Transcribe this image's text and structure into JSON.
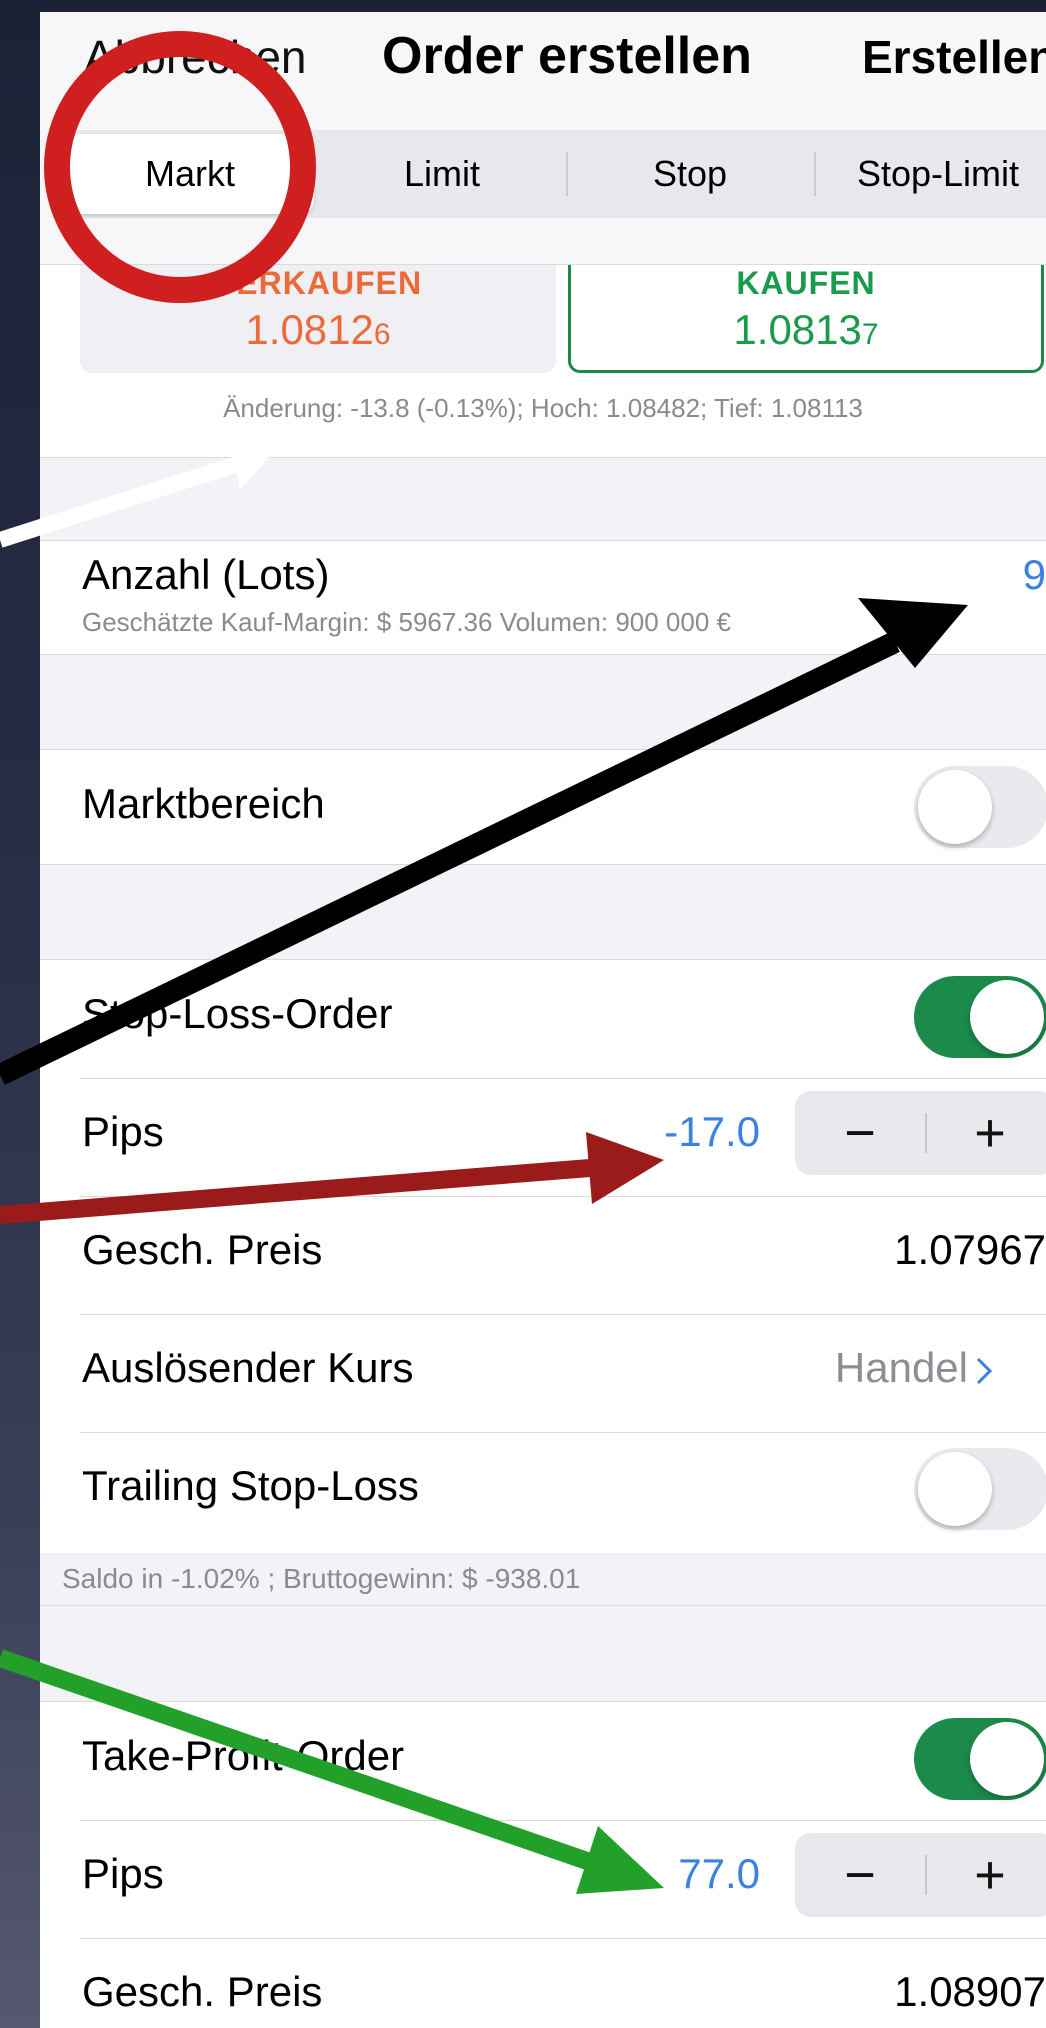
{
  "nav": {
    "cancel_label": "Abbrechen",
    "title": "Order erstellen",
    "create_label": "Erstellen"
  },
  "order_types": [
    "Markt",
    "Limit",
    "Stop",
    "Stop-Limit"
  ],
  "selected_order_type": "Markt",
  "quote": {
    "sell_label": "VERKAUFEN",
    "sell_price_main": "1.0812",
    "sell_price_pip": "6",
    "buy_label": "KAUFEN",
    "buy_price_main": "1.0813",
    "buy_price_pip": "7",
    "info": "Änderung: -13.8 (-0.13%); Hoch: 1.08482; Tief: 1.08113"
  },
  "lots": {
    "label": "Anzahl (Lots)",
    "value": "9",
    "margin_info": "Geschätzte Kauf-Margin: $ 5967.36   Volumen:  900 000 €"
  },
  "market_range": {
    "label": "Marktbereich",
    "enabled": false
  },
  "stop_loss": {
    "label": "Stop-Loss-Order",
    "enabled": true,
    "pips_label": "Pips",
    "pips_value": "-17.0",
    "price_label": "Gesch. Preis",
    "price_value": "1.07967",
    "trigger_label": "Auslösender Kurs",
    "trigger_value": "Handel",
    "trailing_label": "Trailing Stop-Loss",
    "trailing_enabled": false,
    "footnote": "Saldo in -1.02% ; Bruttogewinn: $ -938.01"
  },
  "take_profit": {
    "label": "Take-Profit-Order",
    "enabled": true,
    "pips_label": "Pips",
    "pips_value": "77.0",
    "price_label": "Gesch. Preis",
    "price_value": "1.08907"
  },
  "stepper": {
    "minus": "−",
    "plus": "+"
  },
  "colors": {
    "accent_blue": "#3b82e0",
    "sell_orange": "#ec6a3a",
    "buy_green": "#1a9a4b",
    "toggle_on": "#1b8a4b",
    "annotation_red_circle": "#cf1f1f",
    "annotation_black_arrow": "#000000",
    "annotation_red_arrow": "#9b1a1a",
    "annotation_green_arrow": "#22a02a",
    "annotation_white_arrow": "#ffffff"
  }
}
